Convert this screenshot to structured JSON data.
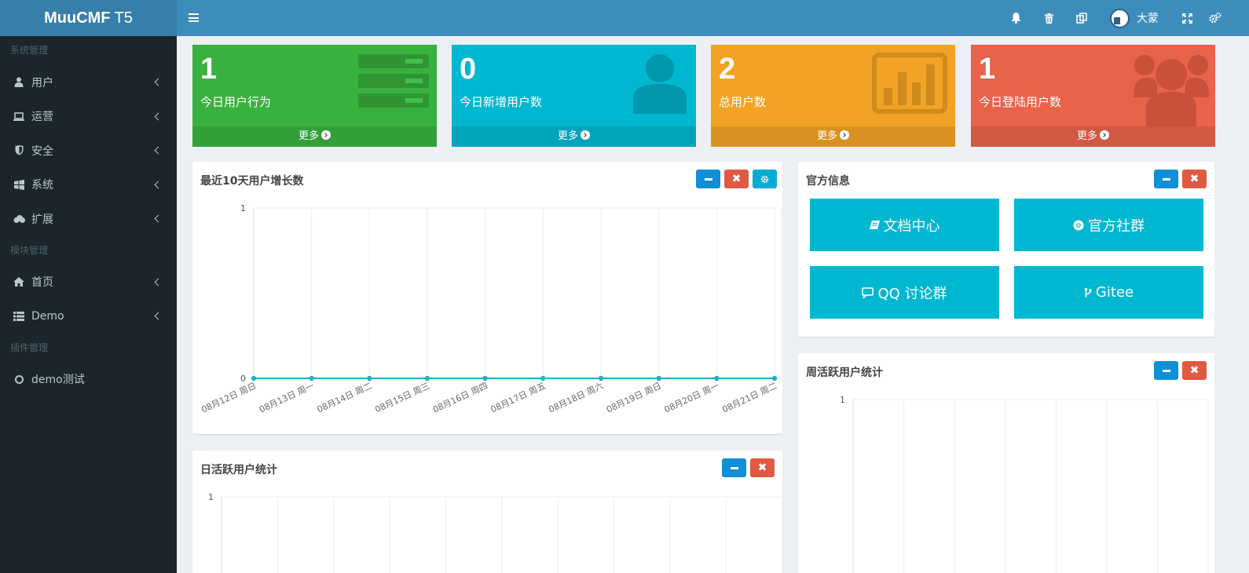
{
  "brand": {
    "bold": "MuuCMF",
    "normal": "T5"
  },
  "sidebar": {
    "header_system": "系统管理",
    "header_module": "模块管理",
    "header_plugin": "插件管理",
    "items": [
      {
        "label": "用户",
        "icon": "user-icon"
      },
      {
        "label": "运营",
        "icon": "laptop-icon"
      },
      {
        "label": "安全",
        "icon": "shield-icon"
      },
      {
        "label": "系统",
        "icon": "windows-icon"
      },
      {
        "label": "扩展",
        "icon": "cloud-icon"
      },
      {
        "label": "首页",
        "icon": "home-icon"
      },
      {
        "label": "Demo",
        "icon": "list-icon"
      },
      {
        "label": "demo测试",
        "icon": "circle-icon"
      }
    ]
  },
  "topbar": {
    "user_name": "大蒙",
    "icons": [
      "bell-icon",
      "trash-icon",
      "copy-icon",
      "expand-icon",
      "gears-icon"
    ]
  },
  "stats": [
    {
      "value": "1",
      "label": "今日用户行为",
      "more": "更多",
      "color": "#39b13f"
    },
    {
      "value": "0",
      "label": "今日新增用户数",
      "more": "更多",
      "color": "#00b7d1"
    },
    {
      "value": "2",
      "label": "总用户数",
      "more": "更多",
      "color": "#f2a325"
    },
    {
      "value": "1",
      "label": "今日登陆用户数",
      "more": "更多",
      "color": "#e9624a"
    }
  ],
  "panels": {
    "growth_title": "最近10天用户增长数",
    "official_title": "官方信息",
    "weekly_title": "周活跃用户统计",
    "daily_title": "日活跃用户统计"
  },
  "official_links": [
    {
      "label": "文档中心",
      "icon": "book-icon"
    },
    {
      "label": "官方社群",
      "icon": "chrome-icon"
    },
    {
      "label": "QQ 讨论群",
      "icon": "comment-icon"
    },
    {
      "label": "Gitee",
      "icon": "git-icon"
    }
  ],
  "chart_data": [
    {
      "type": "line",
      "title": "最近10天用户增长数",
      "categories": [
        "08月12日 周日",
        "08月13日 周一",
        "08月14日 周二",
        "08月15日 周三",
        "08月16日 周四",
        "08月17日 周五",
        "08月18日 周六",
        "08月19日 周日",
        "08月20日 周一",
        "08月21日 周二"
      ],
      "values": [
        0,
        0,
        0,
        0,
        0,
        0,
        0,
        0,
        0,
        0
      ],
      "ylim": [
        0,
        1
      ],
      "yticks": [
        "0",
        "1"
      ],
      "grid": true,
      "color": "#17b3c6"
    },
    {
      "type": "line",
      "title": "日活跃用户统计",
      "categories": [],
      "values": [],
      "ylim": [
        0,
        1
      ],
      "yticks": [
        "1"
      ],
      "grid": true
    },
    {
      "type": "line",
      "title": "周活跃用户统计",
      "categories": [],
      "values": [],
      "ylim": [
        0,
        1
      ],
      "yticks": [
        "1"
      ],
      "grid": true
    }
  ]
}
